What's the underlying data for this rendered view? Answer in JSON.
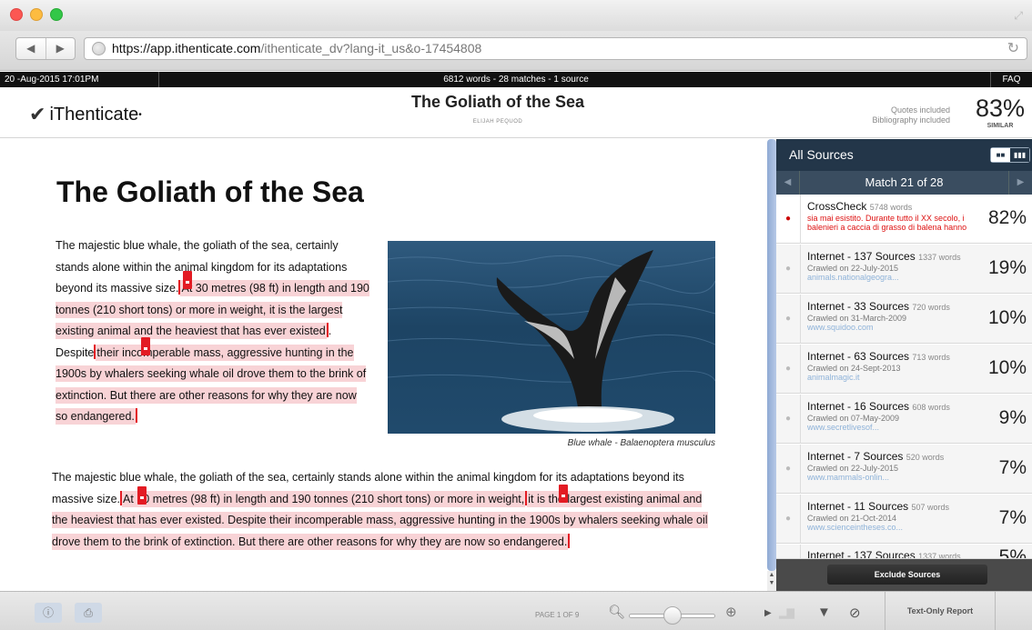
{
  "browser": {
    "url_host": "https://app.ithenticate.com",
    "url_path": "/ithenticate_dv?lang-it_us&o-17454808"
  },
  "statusbar": {
    "datetime": "20 -Aug-2015 17:01PM",
    "summary": "6812 words - 28 matches - 1 source",
    "faq": "FAQ"
  },
  "header": {
    "logo": "iThenticate",
    "doc_title": "The Goliath of the Sea",
    "author": "ELIJAH PEQUOD",
    "quotes": "Quotes included",
    "bibliography": "Bibliography included",
    "similarity": "83%",
    "similar_label": "SIMILAR"
  },
  "document": {
    "heading": "The Goliath of the Sea",
    "p1_plain": "The majestic blue whale, the goliath of the sea, certainly stands alone within the animal kingdom for its adaptations beyond its massive size.",
    "p1_hl1": "At 30 metres (98 ft) in length and 190 tonnes (210 short tons) or more in weight, it is the largest existing animal and the heaviest that has ever existed",
    "p1_mid": ". Despite",
    "p1_hl2": "their incomperable mass, aggressive hunting in the 1900s by whalers seeking whale oil drove them to the brink of extinction. But there are other reasons for why they are now so endangered.",
    "caption": "Blue whale - Balaenoptera musculus",
    "p2_plain": "The majestic blue whale, the goliath of the sea, certainly stands alone within the animal kingdom for its adaptations beyond its massive size.",
    "p2_hl1": "At 30 metres (98 ft) in length and 190 tonnes (210 short tons) or more in weight,",
    "p2_hl2": "it is the largest existing animal and the heaviest that has ever existed. Despite their incomperable mass, aggressive hunting in the 1900s by whalers seeking whale oil drove them to the brink of extinction. But there are other reasons for why they are now so endangered."
  },
  "sidebar": {
    "title": "All Sources",
    "match": "Match 21 of 28",
    "exclude": "Exclude Sources",
    "sources": [
      {
        "title": "CrossCheck",
        "words": "5748 words",
        "snippet": "sia mai esistito. Durante tutto il XX secolo, i balenieri a caccia di grasso di balena hanno",
        "pct": "82%"
      },
      {
        "title": "Internet - 137 Sources",
        "words": "1337 words",
        "crawled": "Crawled on 22-July-2015",
        "link": "animals.nationalgeogra...",
        "pct": "19%"
      },
      {
        "title": "Internet - 33 Sources",
        "words": "720 words",
        "crawled": "Crawled on 31-March-2009",
        "link": "www.squidoo.com",
        "pct": "10%"
      },
      {
        "title": "Internet - 63 Sources",
        "words": "713 words",
        "crawled": "Crawled on 24-Sept-2013",
        "link": "animalmagic.it",
        "pct": "10%"
      },
      {
        "title": "Internet - 16 Sources",
        "words": "608 words",
        "crawled": "Crawled on 07-May-2009",
        "link": "www.secretlivesof...",
        "pct": "9%"
      },
      {
        "title": "Internet - 7 Sources",
        "words": "520 words",
        "crawled": "Crawled on 22-July-2015",
        "link": "www.mammals-onlin...",
        "pct": "7%"
      },
      {
        "title": "Internet - 11 Sources",
        "words": "507 words",
        "crawled": "Crawled on 21-Oct-2014",
        "link": "www.scienceintheses.co...",
        "pct": "7%"
      },
      {
        "title": "Internet - 137 Sources",
        "words": "1337 words",
        "pct": "5%"
      }
    ]
  },
  "toolbar": {
    "page": "PAGE 1 OF 9",
    "zoom_level": 0.5,
    "text_only": "Text-Only Report"
  }
}
